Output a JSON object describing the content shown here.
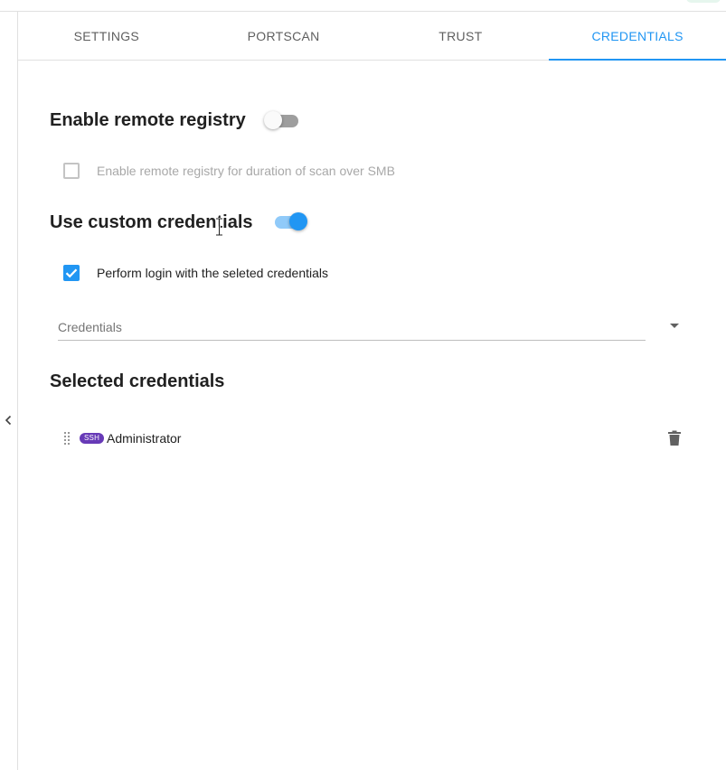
{
  "tabs": [
    {
      "label": "SETTINGS",
      "active": false
    },
    {
      "label": "PORTSCAN",
      "active": false
    },
    {
      "label": "TRUST",
      "active": false
    },
    {
      "label": "CREDENTIALS",
      "active": true
    }
  ],
  "remote_registry": {
    "heading": "Enable remote registry",
    "toggle_on": false,
    "option_label": "Enable remote registry for duration of scan over SMB",
    "option_checked": false,
    "option_disabled": true
  },
  "custom_credentials": {
    "heading": "Use custom credentials",
    "toggle_on": true,
    "option_label": "Perform login with the seleted credentials",
    "option_checked": true
  },
  "credentials_select": {
    "placeholder": "Credentials",
    "icon": "arrow-drop-down-icon"
  },
  "selected_credentials": {
    "heading": "Selected credentials",
    "items": [
      {
        "badge": "SSH",
        "name": "Administrator"
      }
    ]
  },
  "icons": {
    "collapse": "chevron-left-icon",
    "drag": "drag-handle-icon",
    "delete": "trash-icon",
    "checkbox_check": "check-icon"
  },
  "colors": {
    "accent": "#2196f3",
    "badge": "#673ab7",
    "disabled_text": "#a8a8a8"
  }
}
